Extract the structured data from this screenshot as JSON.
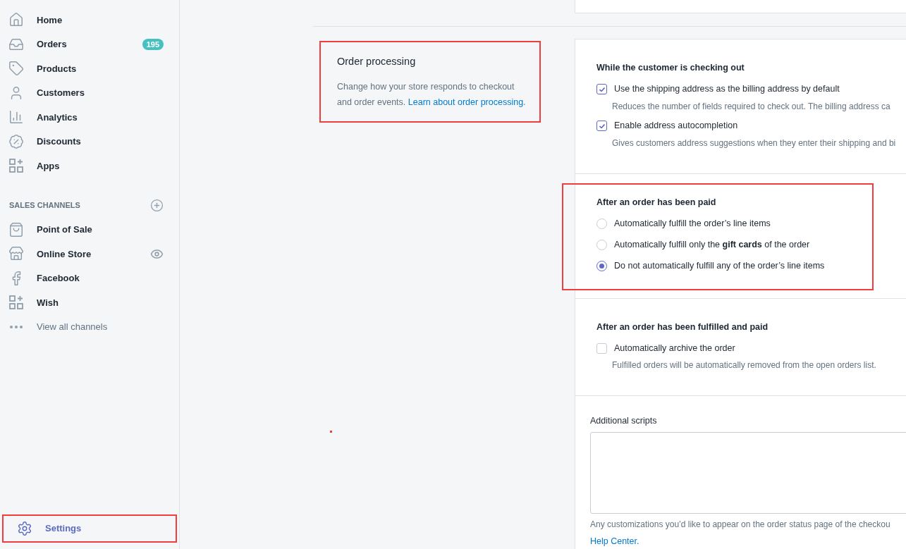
{
  "sidebar": {
    "nav_items": [
      {
        "label": "Home",
        "selected": false
      },
      {
        "label": "Orders",
        "badge": "195",
        "selected": false
      },
      {
        "label": "Products",
        "selected": false
      },
      {
        "label": "Customers",
        "selected": false
      },
      {
        "label": "Analytics",
        "selected": false
      },
      {
        "label": "Discounts",
        "selected": false
      },
      {
        "label": "Apps",
        "selected": false
      }
    ],
    "sales_channels": {
      "heading": "SALES CHANNELS",
      "items": [
        {
          "label": "Point of Sale",
          "selected": false
        },
        {
          "label": "Online Store",
          "selected": false
        },
        {
          "label": "Facebook",
          "selected": false
        },
        {
          "label": "Wish",
          "selected": false
        }
      ],
      "view_all": "View all channels"
    },
    "settings": {
      "label": "Settings",
      "selected": true,
      "highlighted": true
    }
  },
  "section": {
    "title": "Order processing",
    "description": "Change how your store responds to checkout and order events.",
    "link": "Learn about order processing",
    "trailing": ".",
    "highlighted": true
  },
  "card_groups": [
    {
      "kind": "checkbox",
      "title": "While the customer is checking out",
      "highlighted": false,
      "options": [
        {
          "label": "Use the shipping address as the billing address by default",
          "checked": true,
          "help": "Reduces the number of fields required to check out. The billing address ca"
        },
        {
          "label": "Enable address autocompletion",
          "checked": true,
          "help": "Gives customers address suggestions when they enter their shipping and bi"
        }
      ]
    },
    {
      "kind": "radio",
      "title": "After an order has been paid",
      "highlighted": true,
      "options": [
        {
          "label": "Automatically fulfill the order’s line items",
          "selected": false
        },
        {
          "label": "Automatically fulfill only the **gift cards** of the order",
          "selected": false
        },
        {
          "label": "Do not automatically fulfill any of the order’s line items",
          "selected": true
        }
      ]
    },
    {
      "kind": "checkbox",
      "title": "After an order has been fulfilled and paid",
      "highlighted": false,
      "options": [
        {
          "label": "Automatically archive the order",
          "checked": false,
          "help": "Fulfilled orders will be automatically removed from the open orders list."
        }
      ]
    },
    {
      "kind": "textarea",
      "label": "Additional scripts",
      "highlighted": false,
      "help": "Any customizations you’d like to appear on the order status page of the checkou",
      "link": "Help Center."
    }
  ]
}
